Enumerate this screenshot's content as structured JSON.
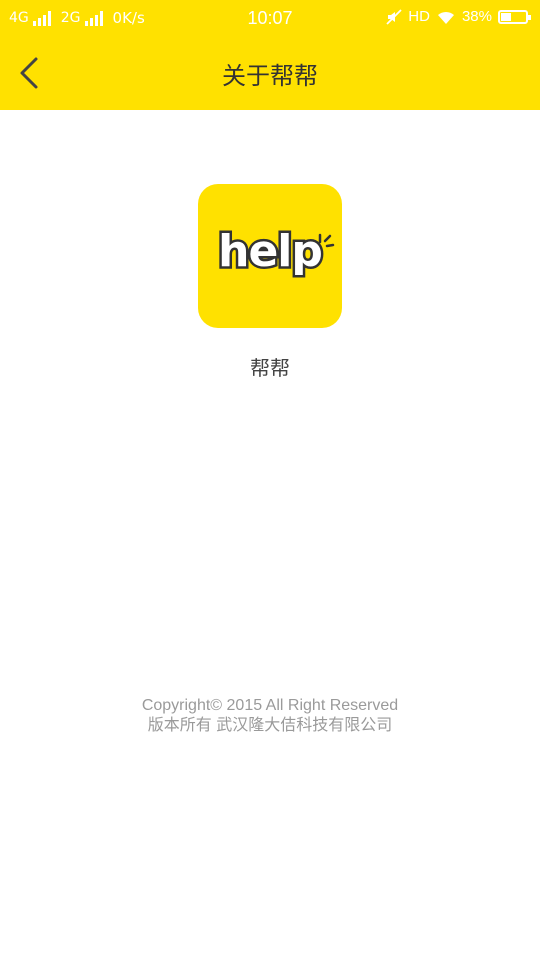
{
  "status_bar": {
    "network1": "4G",
    "network2": "2G",
    "speed": "0K/s",
    "time": "10:07",
    "hd": "HD",
    "battery": "38%",
    "battery_level": 0.38
  },
  "header": {
    "title": "关于帮帮",
    "back_icon": "chevron-left-icon"
  },
  "app": {
    "logo_text": "help",
    "name": "帮帮"
  },
  "footer": {
    "copyright_line1": "Copyright© 2015 All Right Reserved",
    "copyright_line2": "版本所有 武汉隆大佶科技有限公司"
  },
  "colors": {
    "accent": "#FFE100",
    "title_text": "#333333",
    "footer_text": "#9A9A9A"
  }
}
